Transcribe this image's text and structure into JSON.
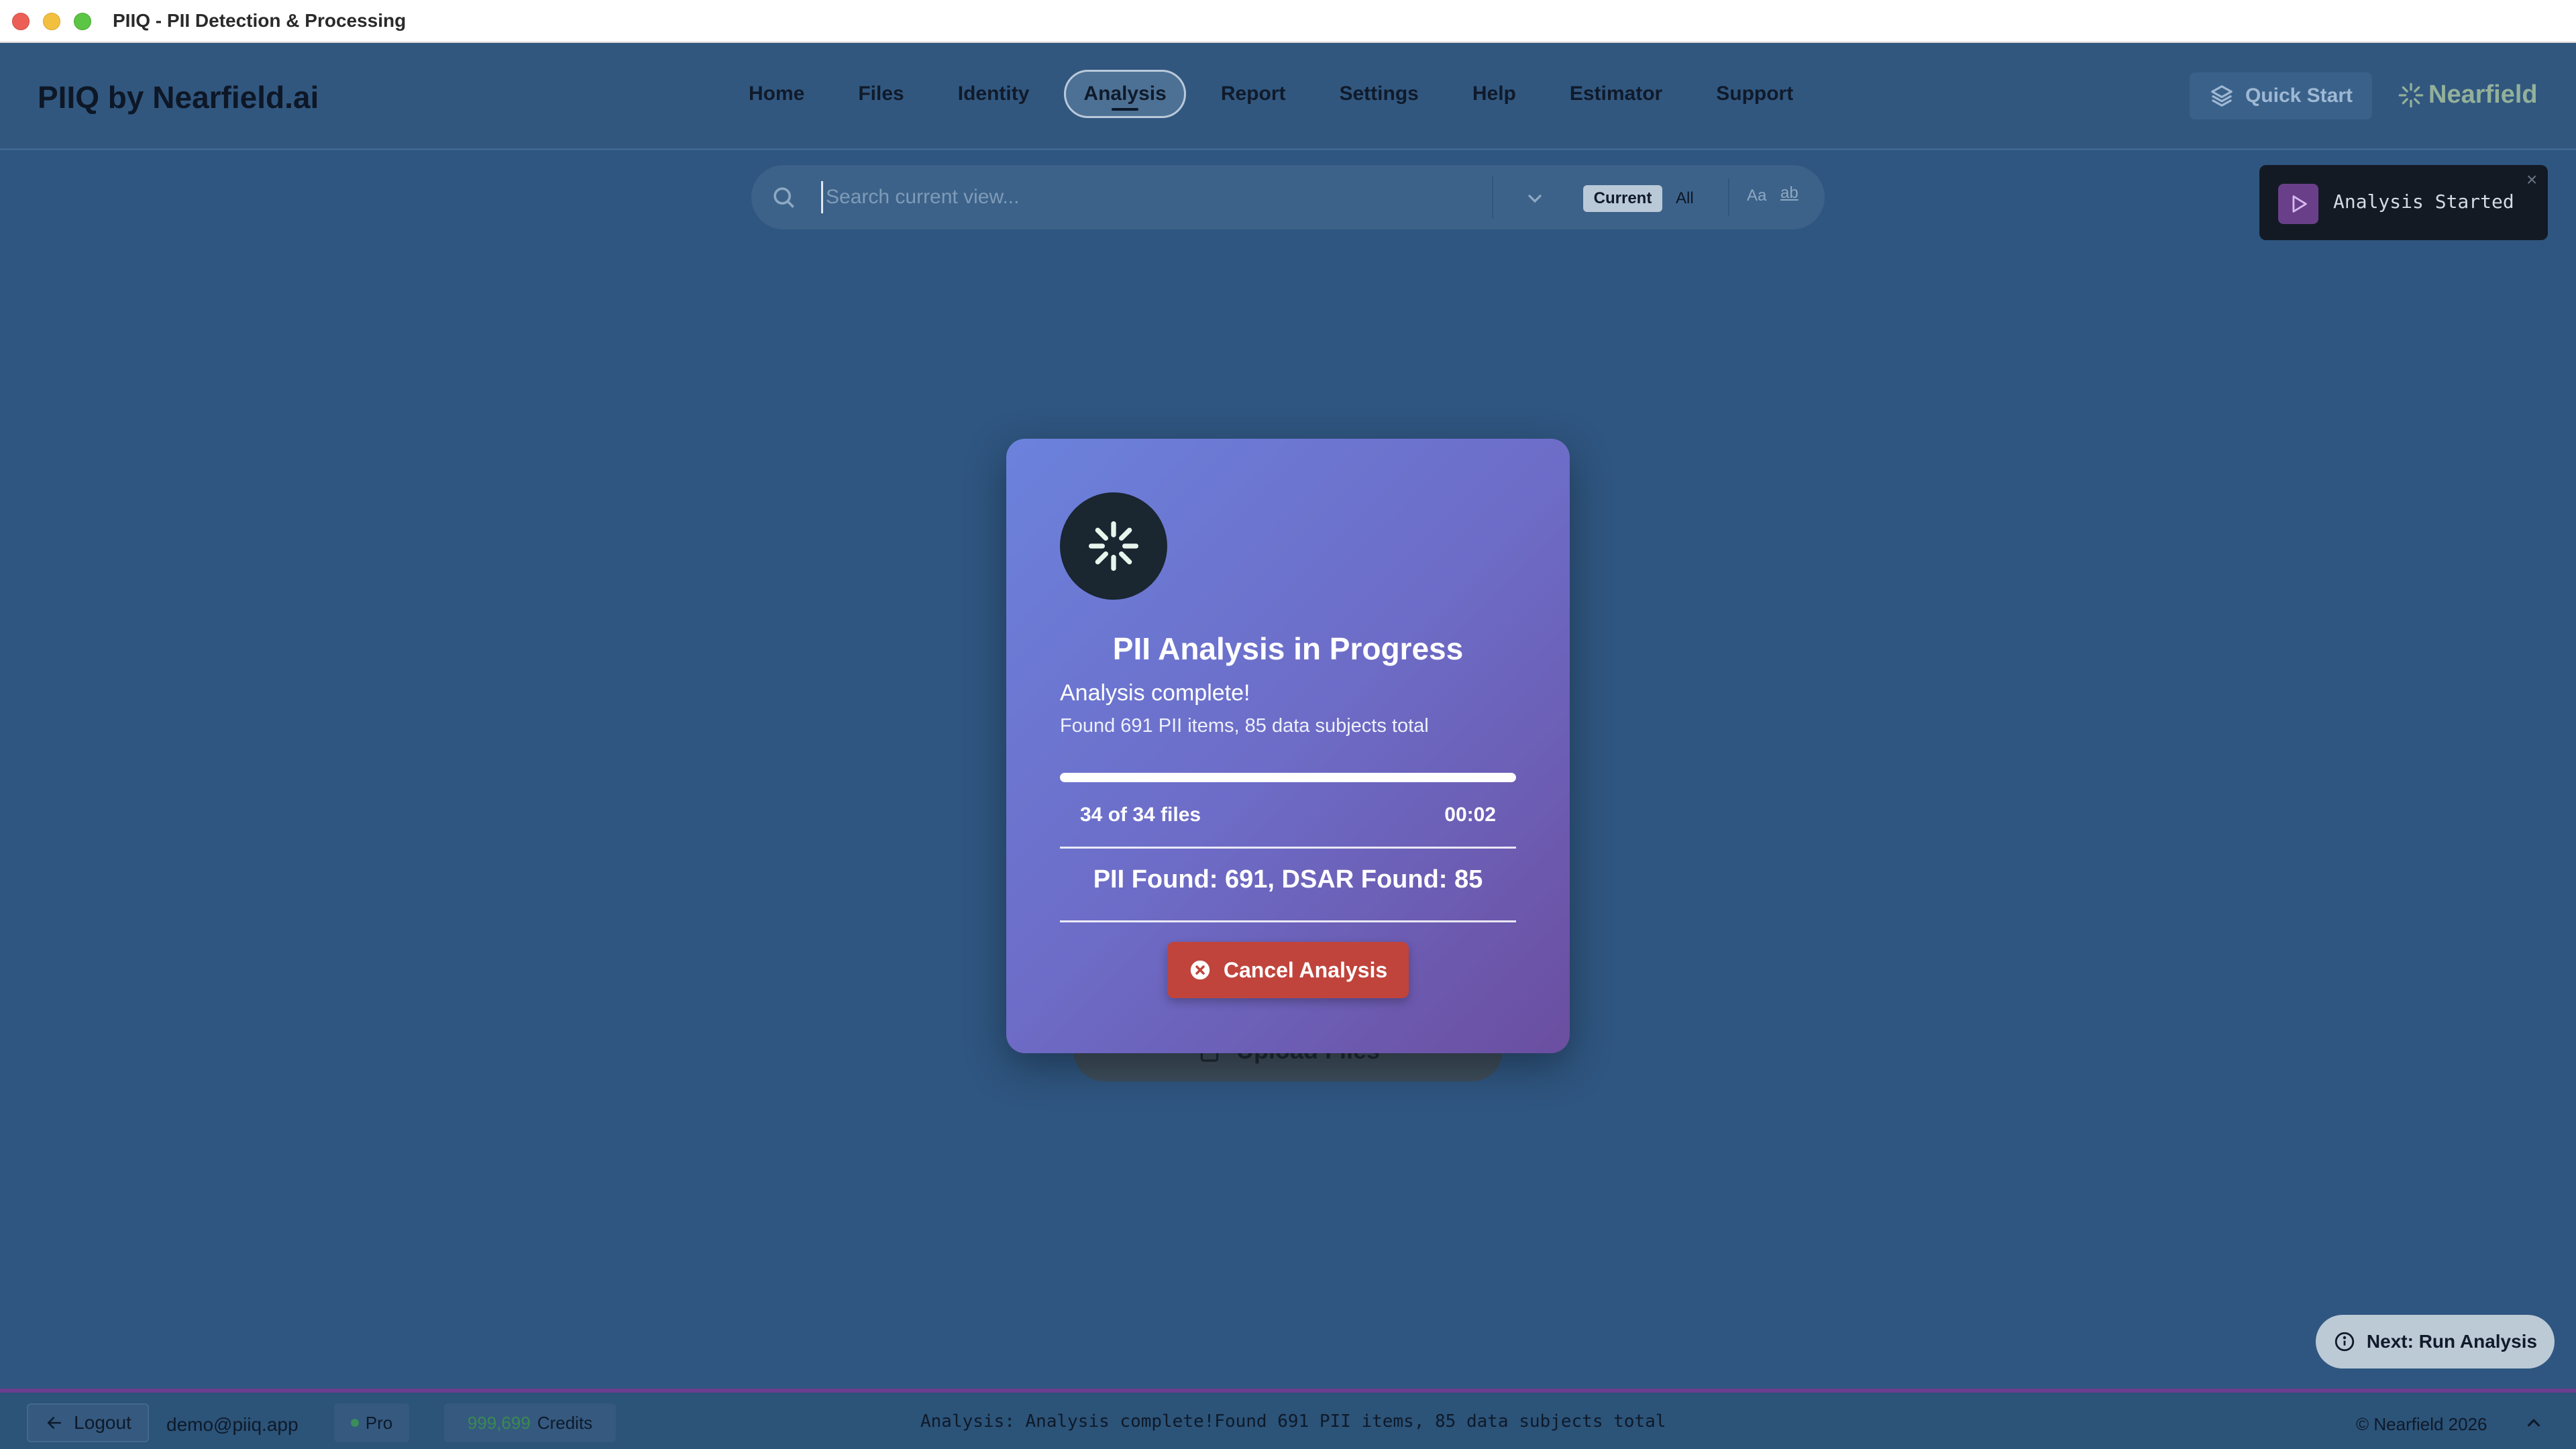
{
  "window": {
    "title": "PIIQ - PII Detection & Processing"
  },
  "header": {
    "brand": "PIIQ by Nearfield.ai",
    "nav": [
      {
        "label": "Home"
      },
      {
        "label": "Files"
      },
      {
        "label": "Identity"
      },
      {
        "label": "Analysis",
        "active": true
      },
      {
        "label": "Report"
      },
      {
        "label": "Settings"
      },
      {
        "label": "Help"
      },
      {
        "label": "Estimator"
      },
      {
        "label": "Support"
      }
    ],
    "quick_start": "Quick Start",
    "logo_text": "Nearfield"
  },
  "search": {
    "placeholder": "Search current view...",
    "value": "",
    "scope_current": "Current",
    "scope_all": "All",
    "match_case": "Aa",
    "whole_word": "ab"
  },
  "toast": {
    "message": "Analysis Started",
    "close": "×"
  },
  "background": {
    "upload_button": "Upload Files"
  },
  "modal": {
    "title": "PII Analysis in Progress",
    "status_title": "Analysis complete!",
    "status_detail": "Found 691 PII items, 85 data subjects total",
    "progress": 1.0,
    "files_progress": "34 of 34 files",
    "elapsed": "00:02",
    "found_summary": "PII Found: 691, DSAR Found: 85",
    "cancel_label": "Cancel Analysis"
  },
  "next_hint": "Next: Run Analysis",
  "footer": {
    "logout": "Logout",
    "email": "demo@piiq.app",
    "plan": "Pro",
    "credits_value": "999,699",
    "credits_label": "Credits",
    "status": "Analysis: Analysis complete!Found 691 PII items, 85 data subjects total",
    "copyright": "© Nearfield 2026"
  },
  "colors": {
    "background": "#2f5680",
    "modal_gradient_start": "#6b82dc",
    "modal_gradient_end": "#6b4ea0",
    "cancel_button": "#c0443c",
    "toast_bg": "#131a24",
    "footer_accent": "#6c3e8e"
  },
  "icons": {
    "search": "search-icon",
    "chevron": "chevron-down-icon",
    "quick_start": "layers-icon",
    "logo": "nearfield-starburst-icon",
    "toast": "play-icon",
    "spinner": "spinner-icon",
    "cancel": "close-circle-icon",
    "next": "info-icon",
    "logout": "arrow-left-icon",
    "expand": "chevron-up-icon",
    "upload": "file-icon"
  }
}
